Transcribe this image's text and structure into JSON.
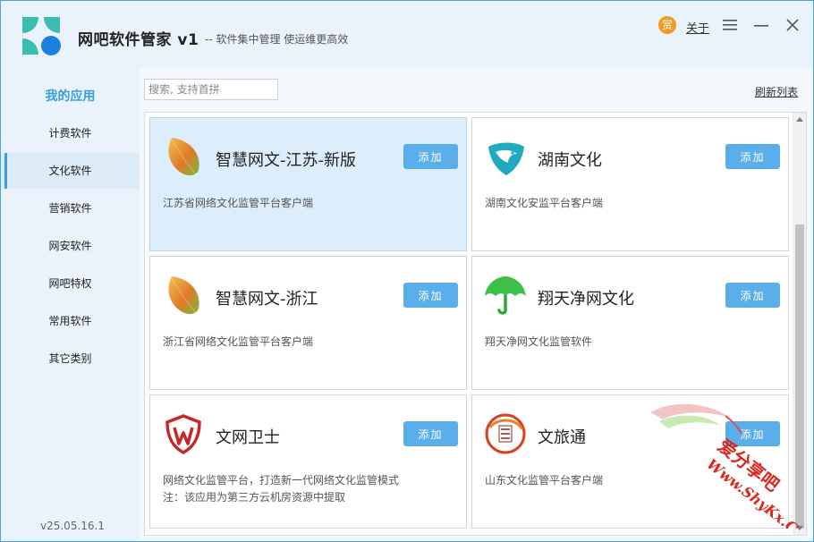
{
  "window": {
    "title": "网吧软件管家 v1",
    "slogan": "-- 软件集中管理  使运维更高效",
    "donate_label": "赏",
    "about_label": "关于"
  },
  "sidebar": {
    "header": "我的应用",
    "items": [
      {
        "label": "计费软件"
      },
      {
        "label": "文化软件"
      },
      {
        "label": "营销软件"
      },
      {
        "label": "网安软件"
      },
      {
        "label": "网吧特权"
      },
      {
        "label": "常用软件"
      },
      {
        "label": "其它类别"
      }
    ],
    "active_index": 1,
    "version": "v25.05.16.1"
  },
  "toolbar": {
    "search_placeholder": "搜索, 支持首拼",
    "search_value": "",
    "refresh_label": "刷新列表"
  },
  "apps": [
    {
      "name": "智慧网文-江苏-新版",
      "desc": "江苏省网络文化监管平台客户端",
      "icon": "leaf-icon",
      "button": "添加",
      "selected": true
    },
    {
      "name": "湖南文化",
      "desc": "湖南文化安监平台客户端",
      "icon": "eagle-shield-icon",
      "button": "添加",
      "selected": false
    },
    {
      "name": "智慧网文-浙江",
      "desc": "浙江省网络文化监管平台客户端",
      "icon": "leaf-icon",
      "button": "添加",
      "selected": false
    },
    {
      "name": "翔天净网文化",
      "desc": "翔天净网文化监管软件",
      "icon": "umbrella-icon",
      "button": "添加",
      "selected": false
    },
    {
      "name": "文网卫士",
      "desc": "网络文化监管平台，打造新一代网络文化监管模式",
      "desc2": "注：该应用为第三方云机房资源中提取",
      "icon": "w-shield-icon",
      "button": "添加",
      "selected": false
    },
    {
      "name": "文旅通",
      "desc": "山东文化监管平台客户端",
      "icon": "wenlvtong-seal-icon",
      "button": "添加",
      "selected": false
    }
  ],
  "watermark": {
    "line1": "爱分享吧",
    "line2": "Www.ShyKx.Com"
  },
  "colors": {
    "accent": "#3d9be0",
    "button": "#5aaee9",
    "selected_card": "#dcedfb",
    "donate": "#f39a1e"
  }
}
